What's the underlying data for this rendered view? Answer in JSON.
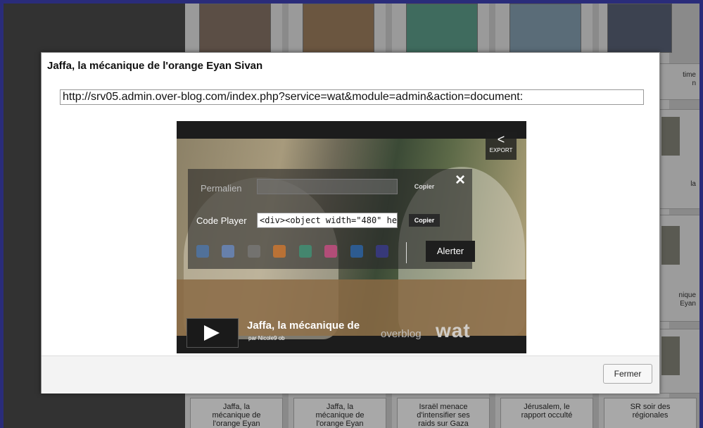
{
  "modal": {
    "title": "Jaffa, la mécanique de l'orange Eyan Sivan",
    "url_value": "http://srv05.admin.over-blog.com/index.php?service=wat&module=admin&action=document:",
    "close_label": "Fermer"
  },
  "player": {
    "export_label": "EXPORT",
    "share_panel": {
      "permalink_label": "Permalien",
      "permalink_value": "",
      "copy_label": "Copier",
      "code_label": "Code Player",
      "code_value": "<div><object width=\"480\" he",
      "copy_label_2": "Copier",
      "alert_label": "Alerter",
      "close_glyph": "×"
    },
    "video_title": "Jaffa, la mécanique de",
    "video_author": "par Nicole9 ob",
    "brand_overblog": "overblog",
    "brand_wat": "wat"
  },
  "background": {
    "right_snippets": [
      "time",
      "n",
      "la",
      "nique",
      "Eyan"
    ],
    "bottom_cards": [
      {
        "line1": "Jaffa, la",
        "line2": "mécanique de",
        "line3": "l'orange Eyan"
      },
      {
        "line1": "Jaffa, la",
        "line2": "mécanique de",
        "line3": "l'orange Eyan"
      },
      {
        "line1": "Israël menace",
        "line2": "d'intensifier ses",
        "line3": "raids sur Gaza"
      },
      {
        "line1": "Jérusalem, le",
        "line2": "rapport occulté",
        "line3": ""
      },
      {
        "line1": "SR soir des",
        "line2": "régionales",
        "line3": ""
      }
    ]
  },
  "colors": {
    "outer_border": "#2a2c7a",
    "modal_bg": "#ffffff",
    "footer_bg": "#f3f3f3"
  },
  "icons": [
    "share-icon",
    "close-icon",
    "play-icon",
    "delicious-icon",
    "digg-icon",
    "facebook-icon",
    "blogger-icon",
    "myspace-icon",
    "stumble-icon",
    "twitter-icon",
    "technorati-icon"
  ]
}
